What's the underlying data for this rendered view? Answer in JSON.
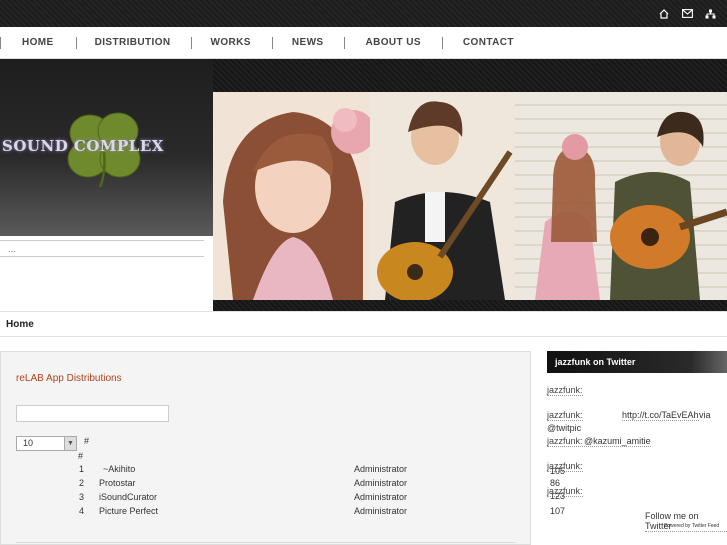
{
  "nav": {
    "items": [
      "HOME",
      "DISTRIBUTION",
      "WORKS",
      "NEWS",
      "ABOUT US",
      "CONTACT"
    ]
  },
  "top_icons": [
    "home-icon",
    "mail-icon",
    "sitemap-icon"
  ],
  "hero": {
    "logo_text": "SOUND COMPLEX",
    "side_text": "..."
  },
  "breadcrumb": "Home",
  "main": {
    "title": "reLAB App Distributions",
    "per_page": "10",
    "hash_header": "#",
    "hash_header_2": "#",
    "rows": [
      {
        "num": "1",
        "name": "~Akihito",
        "author": "Administrator"
      },
      {
        "num": "2",
        "name": "Protostar",
        "author": "Administrator"
      },
      {
        "num": "3",
        "name": "iSoundCurator",
        "author": "Administrator"
      },
      {
        "num": "4",
        "name": "Picture Perfect",
        "author": "Administrator"
      }
    ]
  },
  "sidebar": {
    "title": "jazzfunk on Twitter",
    "tweets": [
      {
        "user": "jazzfunk:",
        "text": ""
      },
      {
        "user": "jazzfunk:",
        "link": "http://t.co/TaEvEAh",
        "text": "via @twitpic"
      },
      {
        "user": "jazzfunk:",
        "text": "@kazumi_amitie"
      },
      {
        "user": "jazzfunk:",
        "text": "105 86"
      },
      {
        "user": "jazzfunk:",
        "text": "123 107"
      }
    ],
    "follow": "Follow me on Twitter",
    "powered": "Powered by Twitter Feed"
  },
  "colors": {
    "accent_title": "#b0431b",
    "topbar": "#1c1c1c"
  }
}
